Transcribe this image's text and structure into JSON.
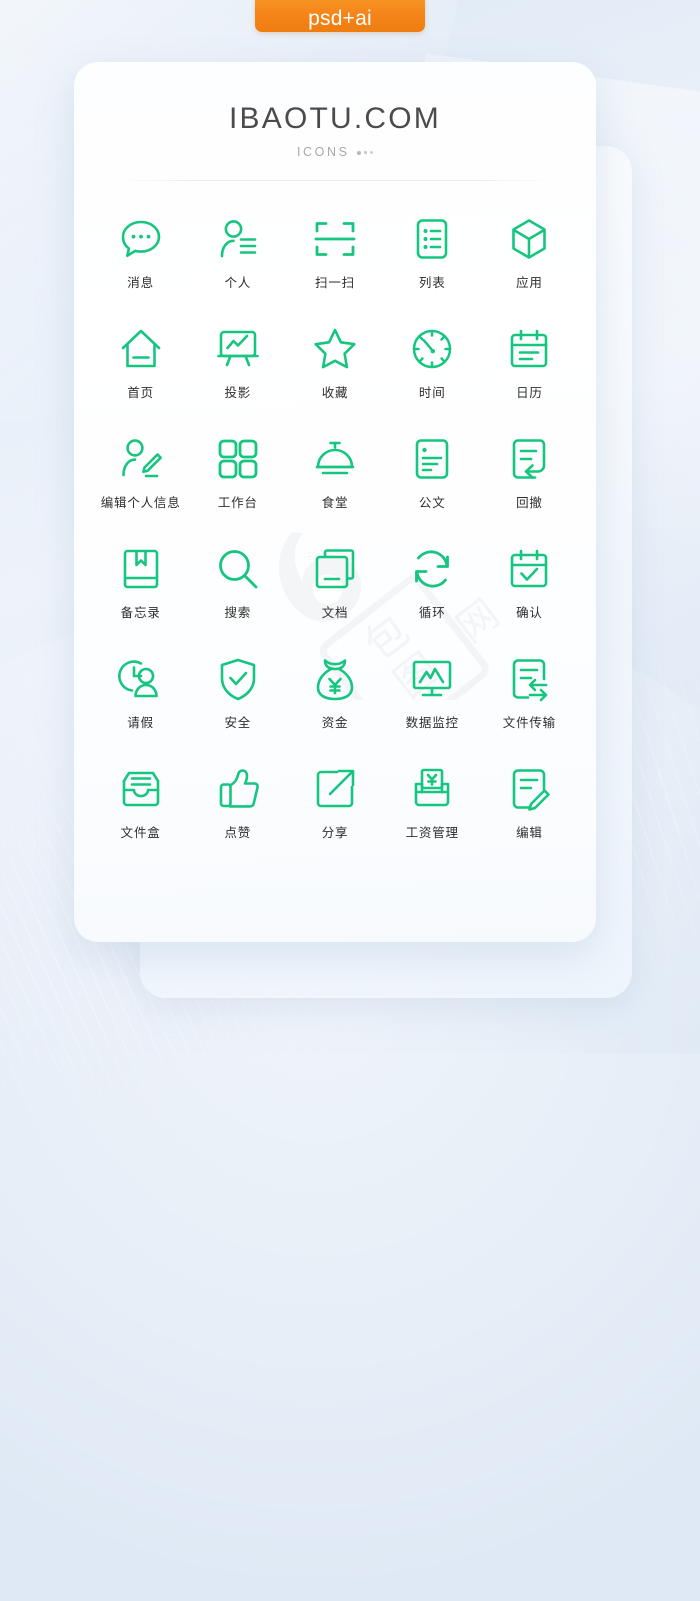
{
  "badge": {
    "label": "psd+ai",
    "color": "#f5851a"
  },
  "header": {
    "title": "IBAOTU.COM",
    "subtitle": "ICONS"
  },
  "theme": {
    "icon_color": "#16c57f",
    "label_color": "#2e2e2e",
    "background": "#dfe9f5",
    "card_background": "#ffffff"
  },
  "watermark": {
    "text": "包图网"
  },
  "icons": [
    {
      "name": "message",
      "label": "消息",
      "glyph": "chat-bubble-dots-icon"
    },
    {
      "name": "personal",
      "label": "个人",
      "glyph": "person-profile-icon"
    },
    {
      "name": "scan",
      "label": "扫一扫",
      "glyph": "scan-frame-icon"
    },
    {
      "name": "list",
      "label": "列表",
      "glyph": "list-document-icon"
    },
    {
      "name": "application",
      "label": "应用",
      "glyph": "cube-box-icon"
    },
    {
      "name": "home",
      "label": "首页",
      "glyph": "house-icon"
    },
    {
      "name": "projection",
      "label": "投影",
      "glyph": "projector-chart-icon"
    },
    {
      "name": "favorite",
      "label": "收藏",
      "glyph": "star-icon"
    },
    {
      "name": "time",
      "label": "时间",
      "glyph": "clock-dial-icon"
    },
    {
      "name": "calendar",
      "label": "日历",
      "glyph": "calendar-icon"
    },
    {
      "name": "edit-profile",
      "label": "编辑个人信息",
      "glyph": "person-pencil-icon"
    },
    {
      "name": "workbench",
      "label": "工作台",
      "glyph": "grid-four-squares-icon"
    },
    {
      "name": "canteen",
      "label": "食堂",
      "glyph": "food-cloche-icon"
    },
    {
      "name": "official-document",
      "label": "公文",
      "glyph": "document-lines-icon"
    },
    {
      "name": "withdraw",
      "label": "回撤",
      "glyph": "document-undo-arrow-icon"
    },
    {
      "name": "memo",
      "label": "备忘录",
      "glyph": "bookmark-book-icon"
    },
    {
      "name": "search",
      "label": "搜索",
      "glyph": "magnifier-icon"
    },
    {
      "name": "documents",
      "label": "文档",
      "glyph": "stacked-pages-icon"
    },
    {
      "name": "loop",
      "label": "循环",
      "glyph": "circular-arrows-icon"
    },
    {
      "name": "confirm",
      "label": "确认",
      "glyph": "calendar-check-icon"
    },
    {
      "name": "leave-request",
      "label": "请假",
      "glyph": "clock-person-icon"
    },
    {
      "name": "security",
      "label": "安全",
      "glyph": "shield-check-icon"
    },
    {
      "name": "funds",
      "label": "资金",
      "glyph": "money-bag-yen-icon"
    },
    {
      "name": "data-monitoring",
      "label": "数据监控",
      "glyph": "monitor-chart-icon"
    },
    {
      "name": "file-transfer",
      "label": "文件传输",
      "glyph": "document-transfer-arrows-icon"
    },
    {
      "name": "file-box",
      "label": "文件盒",
      "glyph": "file-tray-icon"
    },
    {
      "name": "like",
      "label": "点赞",
      "glyph": "thumbs-up-icon"
    },
    {
      "name": "share",
      "label": "分享",
      "glyph": "share-arrow-icon"
    },
    {
      "name": "payroll-management",
      "label": "工资管理",
      "glyph": "payslip-yen-icon"
    },
    {
      "name": "edit",
      "label": "编辑",
      "glyph": "document-pencil-icon"
    }
  ]
}
